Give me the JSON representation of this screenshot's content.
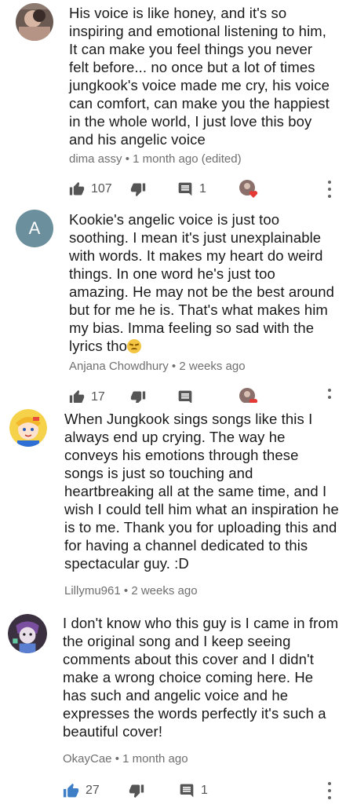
{
  "comments": [
    {
      "author": "dima assy",
      "time": "1 month ago (edited)",
      "text": "His voice is like honey, and it's so inspiring and emotional listening to him, It can make you feel things you never felt before... no once but a lot of times jungkook's voice made me cry, his voice can comfort, can make you the happiest in the whole world, I just love this boy and his angelic voice",
      "likes": "107",
      "replies": "1",
      "creator_heart": true,
      "avatar": "photo"
    },
    {
      "author": "Anjana Chowdhury",
      "time": "2 weeks ago",
      "text": "Kookie's angelic voice is just too soothing. I mean it's just unexplainable with words. It makes my heart do weird things. In one word he's just too amazing. He may not be the best around but for me he is. That's what makes him my bias. Imma feeling so sad with the lyrics tho",
      "avatar_letter": "A",
      "likes": "17",
      "creator_heart": true
    },
    {
      "author": "Lillymu961",
      "time": "2 weeks ago",
      "text": "When Jungkook sings songs like this I always end up crying. The way he conveys his emotions through these songs is just so touching and heartbreaking all at the same time, and I wish I could tell him what an inspiration he is to me. Thank you for uploading this and for having a channel dedicated to this spectacular guy. :D",
      "avatar": "anime"
    },
    {
      "author": "OkayCae",
      "time": "1 month ago",
      "text": "I don't know who this guy is I came in from the original song and I keep seeing comments about this cover and I didn't make a wrong choice coming here. He has such and angelic voice and he expresses the words perfectly it's such a beautiful cover!",
      "likes": "27",
      "replies": "1",
      "liked": true,
      "avatar": "cartoon"
    }
  ],
  "separator": "•",
  "colors": {
    "liked_blue": "#3d7ec7",
    "icon_gray": "#555555",
    "heart_red": "#e53935"
  }
}
